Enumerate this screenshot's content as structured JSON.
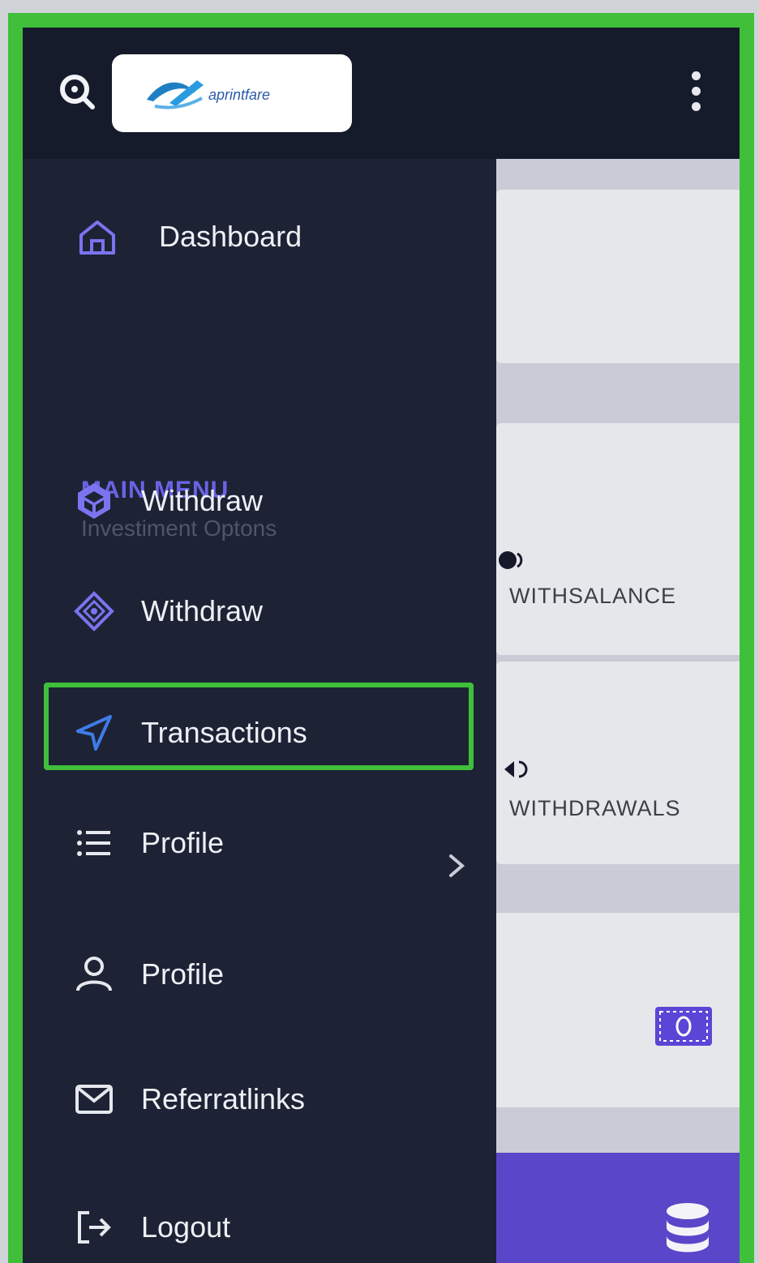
{
  "brand": {
    "logo_text": "aprintfare"
  },
  "nav": {
    "dashboard": "Dashboard",
    "section_title": "MAIN MENU",
    "section_subtitle": "Investiment Optons",
    "withdraw_1": "Withdraw",
    "withdraw_2": "Withdraw",
    "transactions": "Transactions",
    "profile_list": "Profile",
    "profile_user": "Profile",
    "referral": "Referratlinks",
    "logout": "Logout"
  },
  "content": {
    "stat1_label": "WITHSALANCE",
    "stat2_label": "WITHDRAWALS"
  },
  "colors": {
    "accent": "#6a63e6",
    "highlight_border": "#3fbf3a",
    "sidebar_bg": "#1d2335",
    "topbar_bg": "#151b2a",
    "purple_bar": "#5a46c9"
  }
}
